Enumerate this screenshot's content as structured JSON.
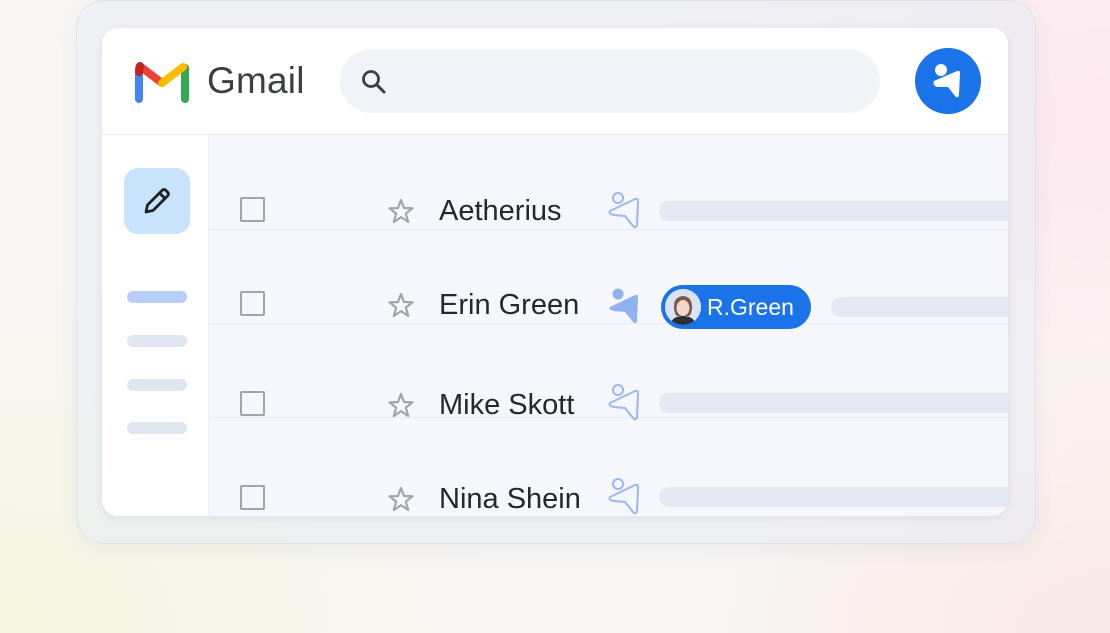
{
  "app": {
    "name": "Gmail"
  },
  "search": {
    "placeholder": "",
    "value": ""
  },
  "emails": [
    {
      "sender": "Aetherius",
      "starred": false,
      "selected": false,
      "tag": null
    },
    {
      "sender": "Erin Green",
      "starred": false,
      "selected": false,
      "tag": "R.Green"
    },
    {
      "sender": "Mike Skott",
      "starred": false,
      "selected": false,
      "tag": null
    },
    {
      "sender": "Nina Shein",
      "starred": false,
      "selected": false,
      "tag": null
    }
  ],
  "colors": {
    "accent": "#1a73e8",
    "compose_bg": "#c8e4fd",
    "nav_active": "#b7cdf5",
    "nav_inactive": "#dfe5f1",
    "preview_bar": "#e5e9f4",
    "ext_icon_active": "#8fb3f2",
    "ext_icon_outline": "#9ab8f0"
  },
  "icons": {
    "logo": "gmail-m-logo",
    "search": "search-icon",
    "avatar": "extension-figure-icon",
    "compose": "pencil-icon",
    "star": "star-outline-icon",
    "extension": "extension-figure-icon"
  }
}
